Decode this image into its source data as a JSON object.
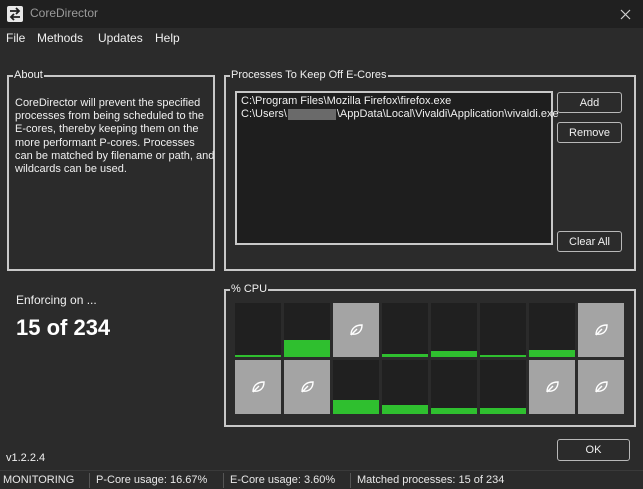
{
  "window": {
    "title": "CoreDirector",
    "app_icon": "swap-arrows-icon",
    "close_icon": "close-icon"
  },
  "menu": [
    "File",
    "Methods",
    "Updates",
    "Help"
  ],
  "about": {
    "title": "About",
    "text": "CoreDirector will prevent the specified processes from being scheduled to the E-cores, thereby keeping them on the more performant P-cores. Processes can be matched by filename or path, and wildcards can be used."
  },
  "processes": {
    "title": "Processes To Keep Off E-Cores",
    "items": [
      {
        "before": "C:\\Program Files\\Mozilla Firefox\\firefox.exe",
        "after": ""
      },
      {
        "before": "C:\\Users\\",
        "after": "\\AppData\\Local\\Vivaldi\\Application\\vivaldi.exe"
      }
    ],
    "add_label": "Add",
    "remove_label": "Remove",
    "clear_label": "Clear All"
  },
  "enforcing": {
    "label": "Enforcing on ...",
    "value": "15 of 234"
  },
  "cpu": {
    "title": "% CPU",
    "cores": [
      {
        "type": "P",
        "usage": 0.04
      },
      {
        "type": "P",
        "usage": 0.31
      },
      {
        "type": "E",
        "usage": 0.0
      },
      {
        "type": "P",
        "usage": 0.06
      },
      {
        "type": "P",
        "usage": 0.11
      },
      {
        "type": "P",
        "usage": 0.02
      },
      {
        "type": "P",
        "usage": 0.13
      },
      {
        "type": "E",
        "usage": 0.0
      },
      {
        "type": "E",
        "usage": 0.0
      },
      {
        "type": "E",
        "usage": 0.0
      },
      {
        "type": "P",
        "usage": 0.26
      },
      {
        "type": "P",
        "usage": 0.17
      },
      {
        "type": "P",
        "usage": 0.11
      },
      {
        "type": "P",
        "usage": 0.11
      },
      {
        "type": "E",
        "usage": 0.0
      },
      {
        "type": "E",
        "usage": 0.0
      }
    ],
    "colors": {
      "p_core_bg": "#202020",
      "e_core_bg": "#a4a4a4",
      "usage": "#2fbf2f"
    },
    "e_core_icon": "leaf-icon"
  },
  "ok_label": "OK",
  "version": "v1.2.2.4",
  "status": {
    "mode": "MONITORING",
    "pcore": "P-Core usage: 16.67%",
    "ecore": "E-Core usage: 3.60%",
    "matched": "Matched processes: 15 of 234"
  }
}
